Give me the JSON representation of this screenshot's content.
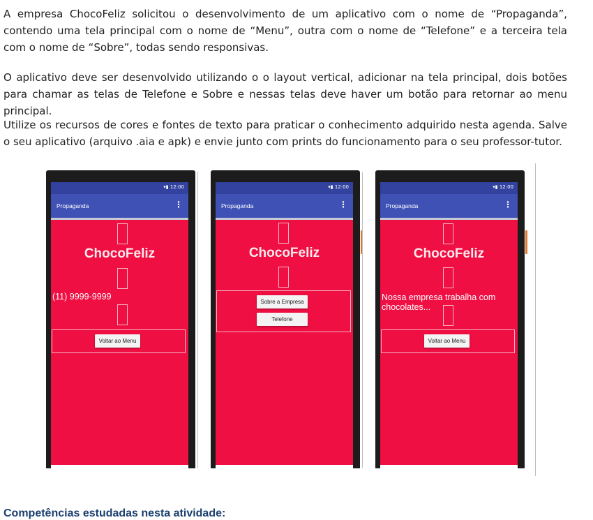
{
  "paragraphs": [
    "A empresa ChocoFeliz solicitou o desenvolvimento de um aplicativo com o nome de “Propaganda”, contendo uma tela principal com o nome de “Menu”, outra com o nome de “Telefone” e a terceira tela com o nome de “Sobre”, todas sendo responsivas.",
    "O aplicativo deve ser desenvolvido utilizando o o layout vertical, adicionar na tela principal, dois botões para chamar as telas de Telefone e Sobre e nessas telas deve haver um botão para retornar ao menu principal.",
    "Utilize os recursos de cores e fontes de texto para praticar o conhecimento adquirido nesta agenda. Salve o seu aplicativo (arquivo .aia e apk) e envie junto com prints do funcionamento para o seu professor-tutor."
  ],
  "phones": {
    "status_time": "12:00",
    "app_title": "Propaganda",
    "menu_glyph": "⋮",
    "brand": "ChocoFeliz",
    "screen1": {
      "info": "(11) 9999-9999",
      "back_button": "Voltar ao Menu"
    },
    "screen2": {
      "about_button": "Sobre a Empresa",
      "phone_button": "Telefone"
    },
    "screen3": {
      "info": "Nossa empresa trabalha com chocolates...",
      "back_button": "Voltar ao Menu"
    }
  },
  "colors": {
    "screen_bg": "#ef0f43",
    "appbar": "#3f51b5",
    "statusbar": "#32429e",
    "heading": "#1b3f6e"
  },
  "section_heading": "Competências estudadas nesta atividade:"
}
